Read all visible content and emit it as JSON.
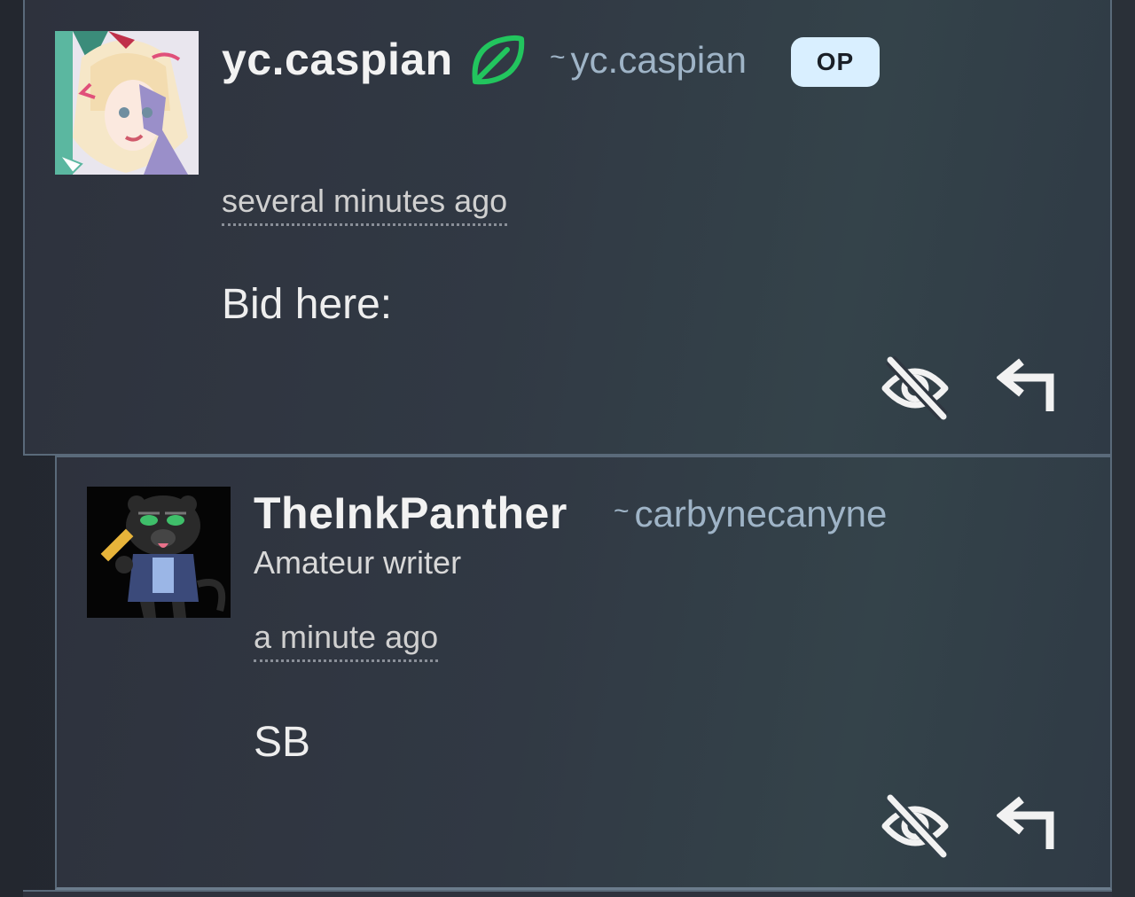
{
  "comments": [
    {
      "username": "yc.caspian",
      "handle_prefix": "~",
      "handle": "yc.caspian",
      "badge": "OP",
      "timestamp": "several minutes ago",
      "body": "Bid here:",
      "icons": {
        "supporter": "leaf-icon",
        "hide": "eye-slash-icon",
        "reply": "reply-arrow-icon"
      }
    },
    {
      "username": "TheInkPanther",
      "handle_prefix": "~",
      "handle": "carbynecanyne",
      "subtitle": "Amateur writer",
      "timestamp": "a minute ago",
      "body": "SB",
      "icons": {
        "hide": "eye-slash-icon",
        "reply": "reply-arrow-icon"
      }
    }
  ],
  "colors": {
    "background": "#262b34",
    "border": "#5a6a7a",
    "handle": "#9fb4c7",
    "badge_bg": "#d9efff",
    "leaf": "#22c55e"
  }
}
